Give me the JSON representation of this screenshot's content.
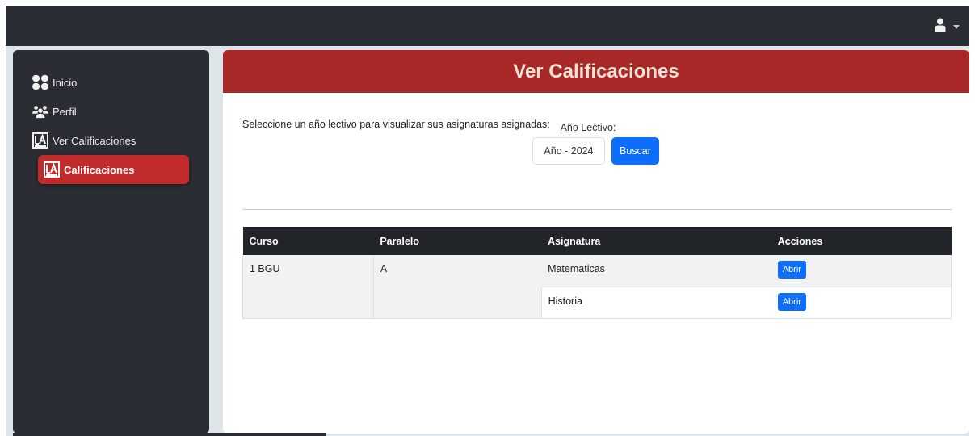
{
  "sidebar": {
    "items": [
      {
        "label": "Inicio",
        "icon": "dashboard-icon"
      },
      {
        "label": "Perfil",
        "icon": "users-icon"
      },
      {
        "label": "Ver Calificaciones",
        "icon": "grade-icon"
      },
      {
        "label": "Calificaciones",
        "icon": "grade-icon",
        "active": true
      }
    ]
  },
  "header": {
    "user_icon": "user-icon",
    "title": "Ver Calificaciones"
  },
  "main": {
    "intro": "Seleccione un año lectivo para visualizar sus asignaturas asignadas:",
    "year_label": "Año Lectivo:",
    "year_value": "Año - 2024",
    "search_button": "Buscar",
    "table": {
      "headers": [
        "Curso",
        "Paralelo",
        "Asignatura",
        "Acciones"
      ],
      "curso": "1 BGU",
      "paralelo": "A",
      "rows": [
        {
          "asignatura": "Matematicas",
          "action": "Abrir"
        },
        {
          "asignatura": "Historia",
          "action": "Abrir"
        }
      ]
    }
  },
  "colors": {
    "header_red": "#a82828",
    "active_item": "#c22b2b",
    "primary": "#0d6efd",
    "dark": "#2a2d33"
  }
}
